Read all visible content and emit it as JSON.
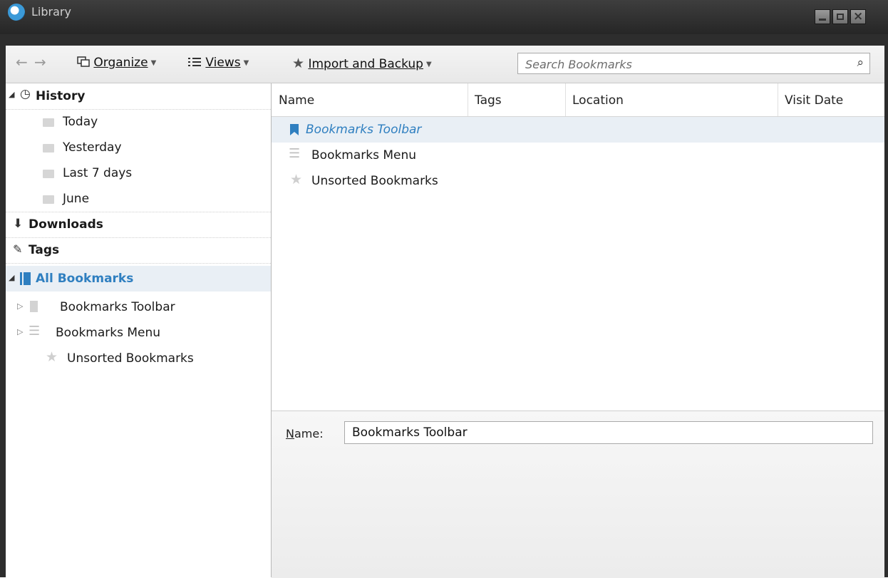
{
  "window": {
    "title": "Library"
  },
  "toolbar": {
    "back": "←",
    "forward": "→",
    "organize_label": "Organize",
    "views_label": "Views",
    "import_label": "Import and Backup",
    "search_placeholder": "Search Bookmarks"
  },
  "sidebar": {
    "history": "History",
    "history_items": [
      "Today",
      "Yesterday",
      "Last 7 days",
      "June"
    ],
    "downloads": "Downloads",
    "tags": "Tags",
    "all_bookmarks": "All Bookmarks",
    "bookmark_items": [
      "Bookmarks Toolbar",
      "Bookmarks Menu",
      "Unsorted Bookmarks"
    ]
  },
  "list": {
    "columns": [
      "Name",
      "Tags",
      "Location",
      "Visit Date"
    ],
    "rows": [
      "Bookmarks Toolbar",
      "Bookmarks Menu",
      "Unsorted Bookmarks"
    ]
  },
  "detail": {
    "name_label": "Name:",
    "name_value": "Bookmarks Toolbar"
  },
  "colors": {
    "accent": "#2f7fc0",
    "selection": "#e9eff5"
  }
}
